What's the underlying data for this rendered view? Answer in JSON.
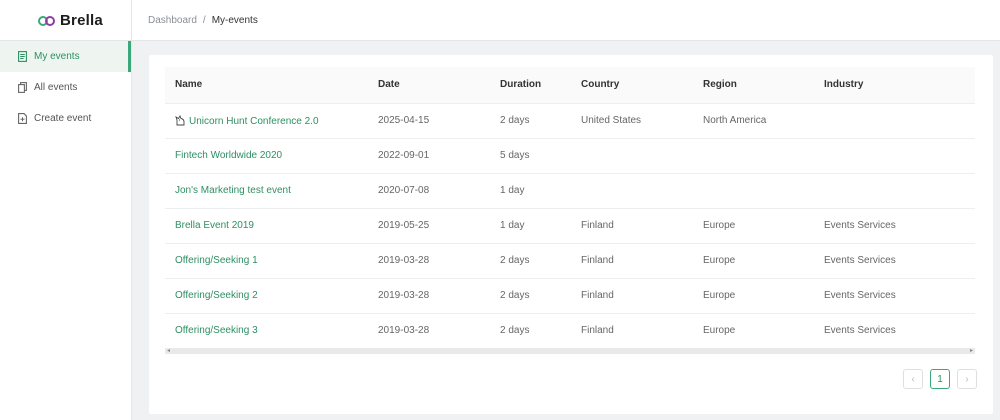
{
  "brand": {
    "name": "Brella"
  },
  "breadcrumb": {
    "root": "Dashboard",
    "separator": "/",
    "current": "My-events"
  },
  "sidebar": {
    "items": [
      {
        "label": "My events",
        "icon": "calendar-list-icon",
        "active": true
      },
      {
        "label": "All events",
        "icon": "copy-icon",
        "active": false
      },
      {
        "label": "Create event",
        "icon": "file-add-icon",
        "active": false
      }
    ]
  },
  "table": {
    "headers": [
      "Name",
      "Date",
      "Duration",
      "Country",
      "Region",
      "Industry"
    ],
    "rows": [
      {
        "name": "Unicorn Hunt Conference 2.0",
        "date": "2025-04-15",
        "duration": "2 days",
        "country": "United States",
        "region": "North America",
        "industry": ""
      },
      {
        "name": "Fintech Worldwide 2020",
        "date": "2022-09-01",
        "duration": "5 days",
        "country": "",
        "region": "",
        "industry": ""
      },
      {
        "name": "Jon's Marketing test event",
        "date": "2020-07-08",
        "duration": "1 day",
        "country": "",
        "region": "",
        "industry": ""
      },
      {
        "name": "Brella Event 2019",
        "date": "2019-05-25",
        "duration": "1 day",
        "country": "Finland",
        "region": "Europe",
        "industry": "Events Services"
      },
      {
        "name": "Offering/Seeking 1",
        "date": "2019-03-28",
        "duration": "2 days",
        "country": "Finland",
        "region": "Europe",
        "industry": "Events Services"
      },
      {
        "name": "Offering/Seeking 2",
        "date": "2019-03-28",
        "duration": "2 days",
        "country": "Finland",
        "region": "Europe",
        "industry": "Events Services"
      },
      {
        "name": "Offering/Seeking 3",
        "date": "2019-03-28",
        "duration": "2 days",
        "country": "Finland",
        "region": "Europe",
        "industry": "Events Services"
      }
    ]
  },
  "pagination": {
    "prev": "‹",
    "current_page": "1",
    "next": "›"
  },
  "colors": {
    "accent": "#3ba87c",
    "link": "#2e8f62",
    "logo_secondary": "#8d3ea3"
  }
}
